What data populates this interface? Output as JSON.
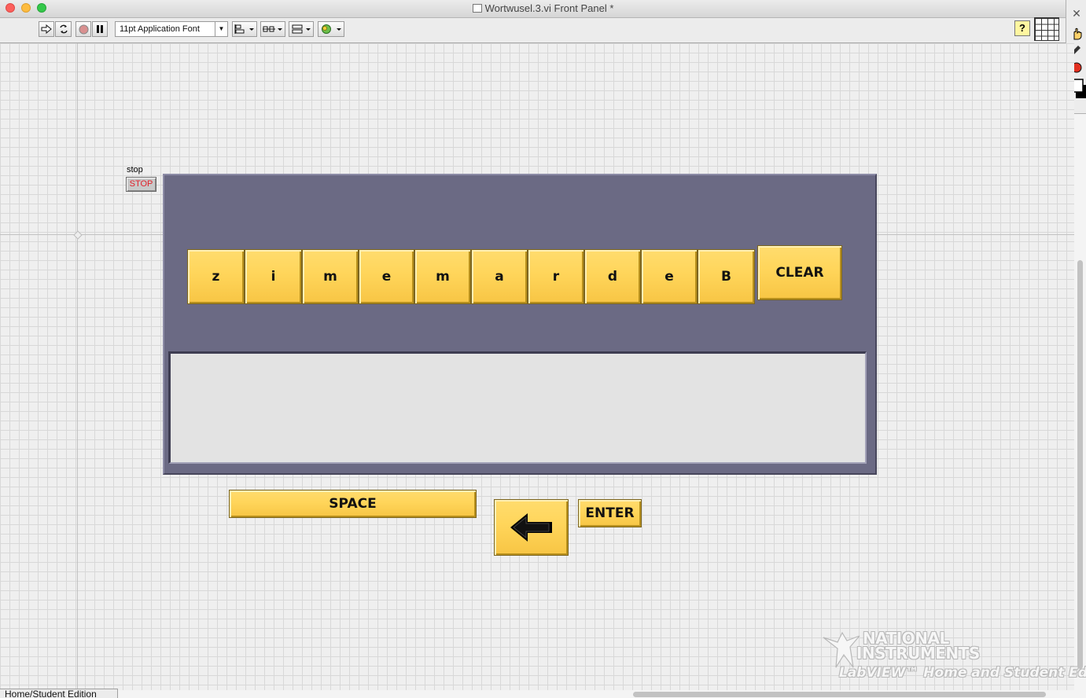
{
  "window": {
    "title": "Wortwusel.3.vi Front Panel *"
  },
  "toolbar": {
    "font_select": "11pt Application Font",
    "help_label": "?"
  },
  "stop_control": {
    "label": "stop",
    "button_text": "STOP"
  },
  "letters": [
    "z",
    "i",
    "m",
    "e",
    "m",
    "a",
    "r",
    "d",
    "e",
    "B"
  ],
  "buttons": {
    "clear": "CLEAR",
    "space": "SPACE",
    "enter": "ENTER"
  },
  "output": {
    "value": ""
  },
  "watermark": {
    "line1": "NATIONAL",
    "line2": "INSTRUMENTS",
    "line3": "LabVIEW™ Home and Student Edition"
  },
  "status_bar": {
    "text": "Home/Student Edition"
  },
  "colors": {
    "key_yellow": "#ffd55a",
    "panel_slate": "#6b6a84",
    "output_bg": "#e3e3e3",
    "stop_text_red": "#e0202a"
  }
}
